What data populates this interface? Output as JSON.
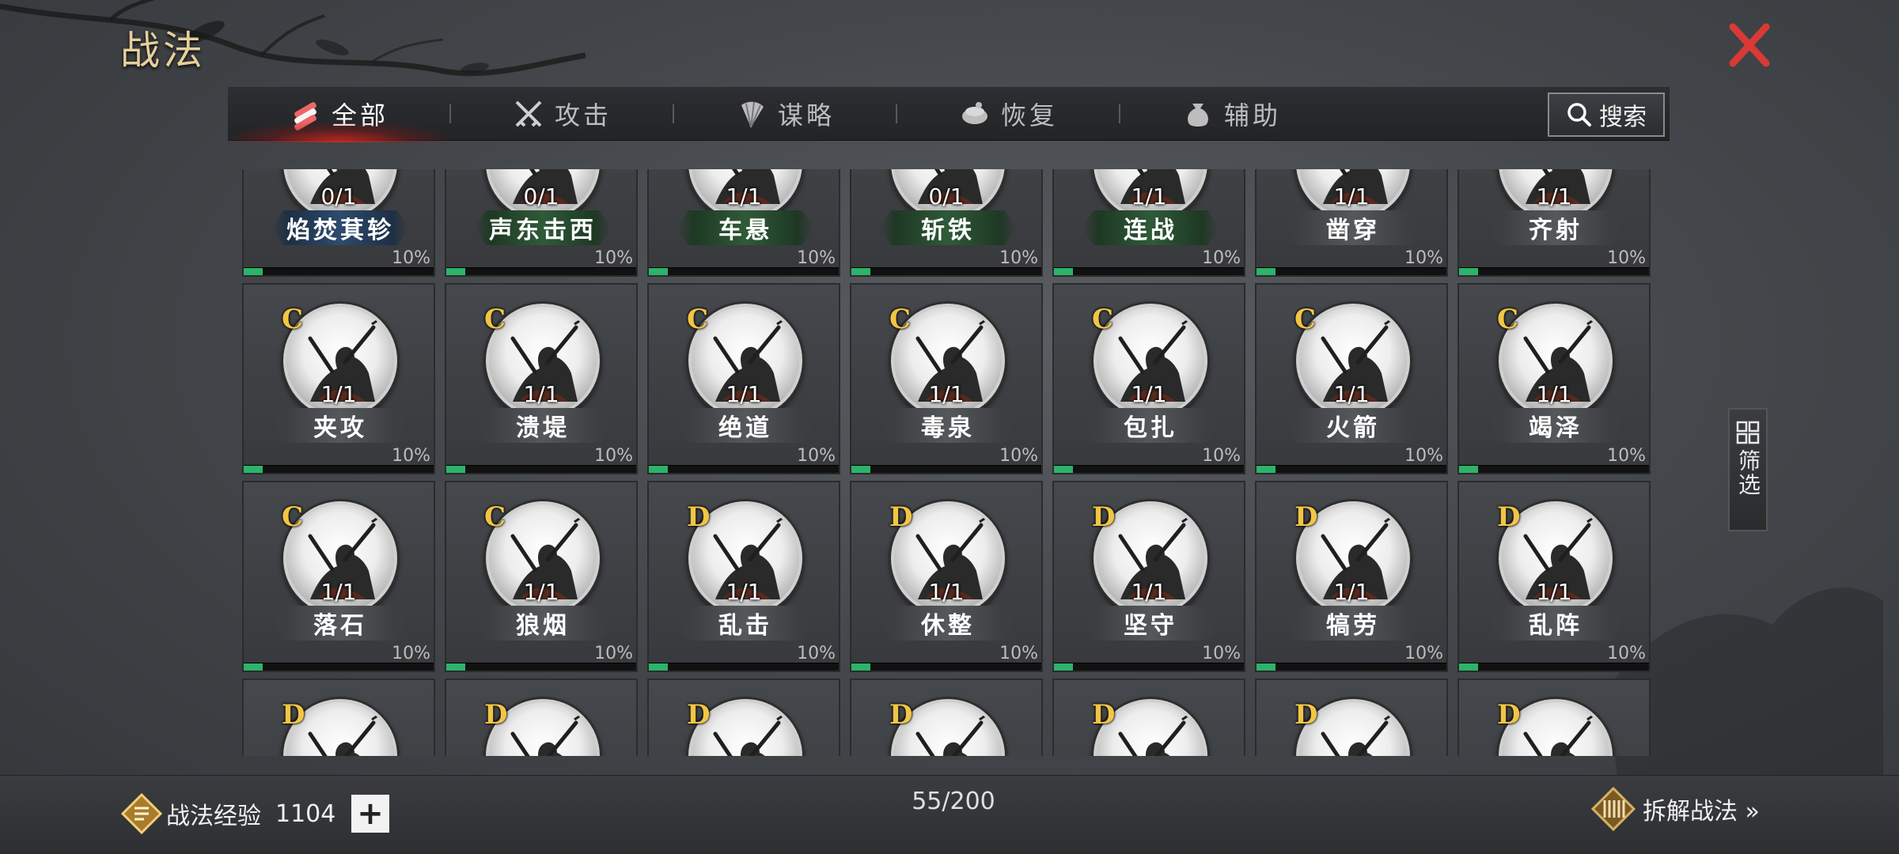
{
  "title": "战法",
  "tabs": [
    {
      "label": "全部",
      "icon": "scroll-bundle-icon",
      "active": true
    },
    {
      "label": "攻击",
      "icon": "crossed-swords-icon",
      "active": false
    },
    {
      "label": "谋略",
      "icon": "feather-fan-icon",
      "active": false
    },
    {
      "label": "恢复",
      "icon": "medicine-bowl-icon",
      "active": false
    },
    {
      "label": "辅助",
      "icon": "pouch-icon",
      "active": false
    }
  ],
  "search_label": "搜索",
  "filter_label": "筛选",
  "cards": [
    {
      "name": "焰焚萁轸",
      "grade": "",
      "count": "0/1",
      "pct": "10%",
      "plate": "blue",
      "progress": 0.1
    },
    {
      "name": "声东击西",
      "grade": "",
      "count": "0/1",
      "pct": "10%",
      "plate": "green",
      "progress": 0.1
    },
    {
      "name": "车悬",
      "grade": "",
      "count": "1/1",
      "pct": "10%",
      "plate": "green",
      "progress": 0.1
    },
    {
      "name": "斩铁",
      "grade": "",
      "count": "0/1",
      "pct": "10%",
      "plate": "green",
      "progress": 0.1
    },
    {
      "name": "连战",
      "grade": "",
      "count": "1/1",
      "pct": "10%",
      "plate": "green",
      "progress": 0.1
    },
    {
      "name": "凿穿",
      "grade": "",
      "count": "1/1",
      "pct": "10%",
      "plate": "gray",
      "progress": 0.1
    },
    {
      "name": "齐射",
      "grade": "",
      "count": "1/1",
      "pct": "10%",
      "plate": "gray",
      "progress": 0.1
    },
    {
      "name": "夹攻",
      "grade": "C",
      "count": "1/1",
      "pct": "10%",
      "plate": "gray",
      "progress": 0.1
    },
    {
      "name": "溃堤",
      "grade": "C",
      "count": "1/1",
      "pct": "10%",
      "plate": "gray",
      "progress": 0.1
    },
    {
      "name": "绝道",
      "grade": "C",
      "count": "1/1",
      "pct": "10%",
      "plate": "gray",
      "progress": 0.1
    },
    {
      "name": "毒泉",
      "grade": "C",
      "count": "1/1",
      "pct": "10%",
      "plate": "gray",
      "progress": 0.1
    },
    {
      "name": "包扎",
      "grade": "C",
      "count": "1/1",
      "pct": "10%",
      "plate": "gray",
      "progress": 0.1
    },
    {
      "name": "火箭",
      "grade": "C",
      "count": "1/1",
      "pct": "10%",
      "plate": "gray",
      "progress": 0.1
    },
    {
      "name": "竭泽",
      "grade": "C",
      "count": "1/1",
      "pct": "10%",
      "plate": "gray",
      "progress": 0.1
    },
    {
      "name": "落石",
      "grade": "C",
      "count": "1/1",
      "pct": "10%",
      "plate": "gray",
      "progress": 0.1
    },
    {
      "name": "狼烟",
      "grade": "C",
      "count": "1/1",
      "pct": "10%",
      "plate": "gray",
      "progress": 0.1
    },
    {
      "name": "乱击",
      "grade": "D",
      "count": "1/1",
      "pct": "10%",
      "plate": "gray",
      "progress": 0.1
    },
    {
      "name": "休整",
      "grade": "D",
      "count": "1/1",
      "pct": "10%",
      "plate": "gray",
      "progress": 0.1
    },
    {
      "name": "坚守",
      "grade": "D",
      "count": "1/1",
      "pct": "10%",
      "plate": "gray",
      "progress": 0.1
    },
    {
      "name": "犒劳",
      "grade": "D",
      "count": "1/1",
      "pct": "10%",
      "plate": "gray",
      "progress": 0.1
    },
    {
      "name": "乱阵",
      "grade": "D",
      "count": "1/1",
      "pct": "10%",
      "plate": "gray",
      "progress": 0.1
    },
    {
      "name": "",
      "grade": "D",
      "count": "",
      "pct": "",
      "plate": "gray",
      "progress": 0
    },
    {
      "name": "",
      "grade": "D",
      "count": "",
      "pct": "",
      "plate": "gray",
      "progress": 0
    },
    {
      "name": "",
      "grade": "D",
      "count": "",
      "pct": "",
      "plate": "gray",
      "progress": 0
    },
    {
      "name": "",
      "grade": "D",
      "count": "",
      "pct": "",
      "plate": "gray",
      "progress": 0
    },
    {
      "name": "",
      "grade": "D",
      "count": "",
      "pct": "",
      "plate": "gray",
      "progress": 0
    },
    {
      "name": "",
      "grade": "D",
      "count": "",
      "pct": "",
      "plate": "gray",
      "progress": 0
    },
    {
      "name": "",
      "grade": "D",
      "count": "",
      "pct": "",
      "plate": "gray",
      "progress": 0
    }
  ],
  "bottom": {
    "exp_label": "战法经验",
    "exp_value": "1104",
    "plus_label": "+",
    "capacity": "55/200",
    "dismantle_label": "拆解战法 »"
  },
  "colors": {
    "title_gold": "#e6cf9a",
    "grade_gold": "#f1c545",
    "progress_green": "#2db36a",
    "close_red": "#d83a35",
    "tab_active_glow": "#dc281e"
  }
}
